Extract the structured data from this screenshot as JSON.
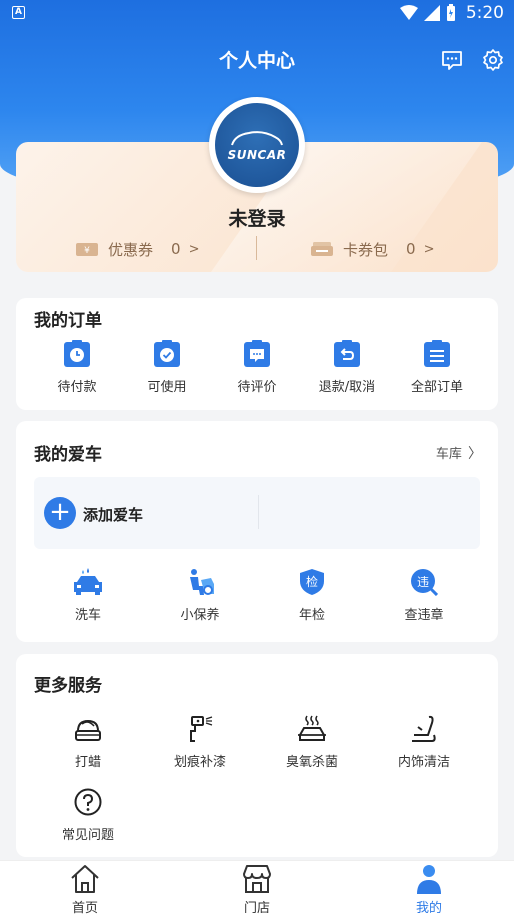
{
  "status_bar": {
    "time": "5:20",
    "app_icon_letter": "A"
  },
  "header": {
    "title": "个人中心"
  },
  "profile": {
    "avatar_logo_text": "SUNCAR",
    "name": "未登录",
    "coupons": {
      "label": "优惠券",
      "count": "0",
      "arrow": ">"
    },
    "card_pack": {
      "label": "卡券包",
      "count": "0",
      "arrow": ">"
    }
  },
  "orders": {
    "title": "我的订单",
    "items": [
      {
        "label": "待付款",
        "icon": "clock-clipboard-icon"
      },
      {
        "label": "可使用",
        "icon": "check-clipboard-icon"
      },
      {
        "label": "待评价",
        "icon": "comment-clipboard-icon"
      },
      {
        "label": "退款/取消",
        "icon": "refund-clipboard-icon"
      },
      {
        "label": "全部订单",
        "icon": "list-clipboard-icon"
      }
    ]
  },
  "my_car": {
    "title": "我的爱车",
    "garage_link": "车库",
    "add_car_label": "添加爱车",
    "items": [
      {
        "label": "洗车",
        "icon": "car-wash-icon"
      },
      {
        "label": "小保养",
        "icon": "maintenance-icon"
      },
      {
        "label": "年检",
        "icon": "inspection-shield-icon",
        "badge": "检"
      },
      {
        "label": "查违章",
        "icon": "violation-search-icon",
        "badge": "违"
      }
    ]
  },
  "more_services": {
    "title": "更多服务",
    "items": [
      {
        "label": "打蜡",
        "icon": "wax-icon"
      },
      {
        "label": "划痕补漆",
        "icon": "spray-paint-icon"
      },
      {
        "label": "臭氧杀菌",
        "icon": "ozone-car-icon"
      },
      {
        "label": "内饰清洁",
        "icon": "seat-clean-icon"
      },
      {
        "label": "常见问题",
        "icon": "question-icon"
      }
    ]
  },
  "tabbar": {
    "items": [
      {
        "label": "首页",
        "icon": "home-icon"
      },
      {
        "label": "门店",
        "icon": "store-icon"
      },
      {
        "label": "我的",
        "icon": "user-icon",
        "active": true
      }
    ]
  },
  "colors": {
    "primary": "#2f7be6",
    "header_blue": "#1e6fe0",
    "wallet_text": "#8a6a4e"
  }
}
